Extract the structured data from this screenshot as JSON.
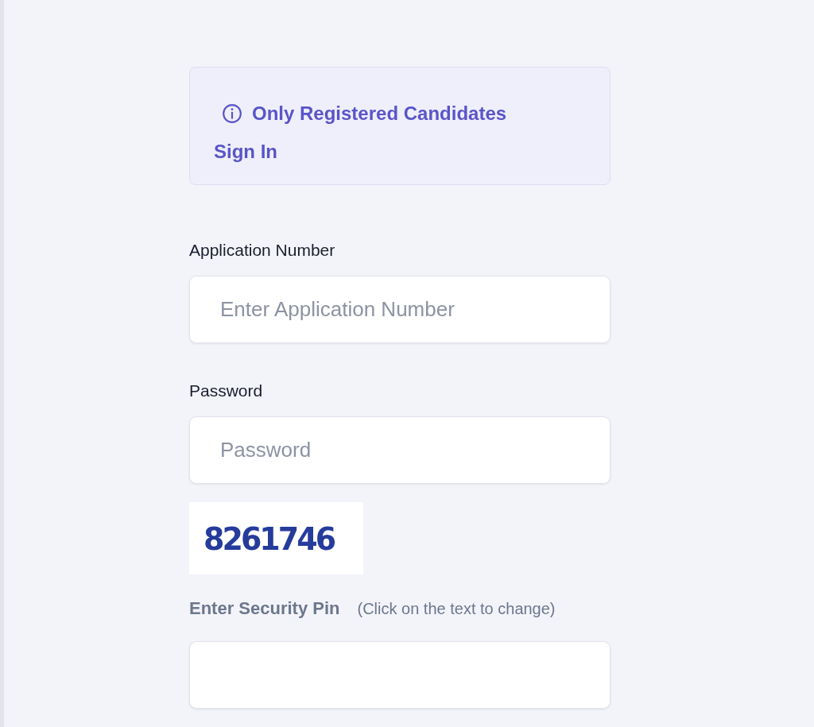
{
  "notice": {
    "lines": [
      "Only Registered Candidates",
      "Sign In"
    ]
  },
  "fields": [
    {
      "label": "Application Number",
      "placeholder": "Enter Application Number"
    },
    {
      "label": "Password",
      "placeholder": "Password"
    }
  ],
  "captcha": {
    "code": "8261746"
  },
  "security_pin": {
    "label": "Enter Security Pin",
    "hint": "(Click on the text to change)"
  }
}
